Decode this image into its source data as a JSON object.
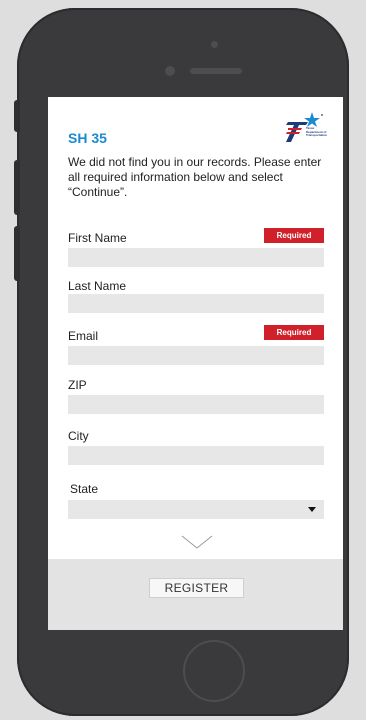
{
  "app": {
    "title": "SH 35",
    "logo_text": "Texas Department of Transportation"
  },
  "intro_text": "We did not find you in our records. Please enter all required information below and select “Continue”.",
  "required_label": "Required",
  "fields": {
    "first_name": {
      "label": "First Name",
      "value": "",
      "required": true
    },
    "last_name": {
      "label": "Last Name",
      "value": "",
      "required": false
    },
    "email": {
      "label": "Email",
      "value": "",
      "required": true
    },
    "zip": {
      "label": "ZIP",
      "value": "",
      "required": false
    },
    "city": {
      "label": "City",
      "value": "",
      "required": false
    },
    "state": {
      "label": "State",
      "selected": "",
      "required": false
    }
  },
  "register_label": "REGISTER",
  "colors": {
    "accent": "#1b8ad1",
    "required": "#d0202a",
    "field_bg": "#e7e7e7",
    "phone_body": "#3a3a3c"
  },
  "icons": {
    "scroll": "chevron-down-icon",
    "dropdown": "caret-down-icon",
    "logo": "txdot-star-logo"
  }
}
